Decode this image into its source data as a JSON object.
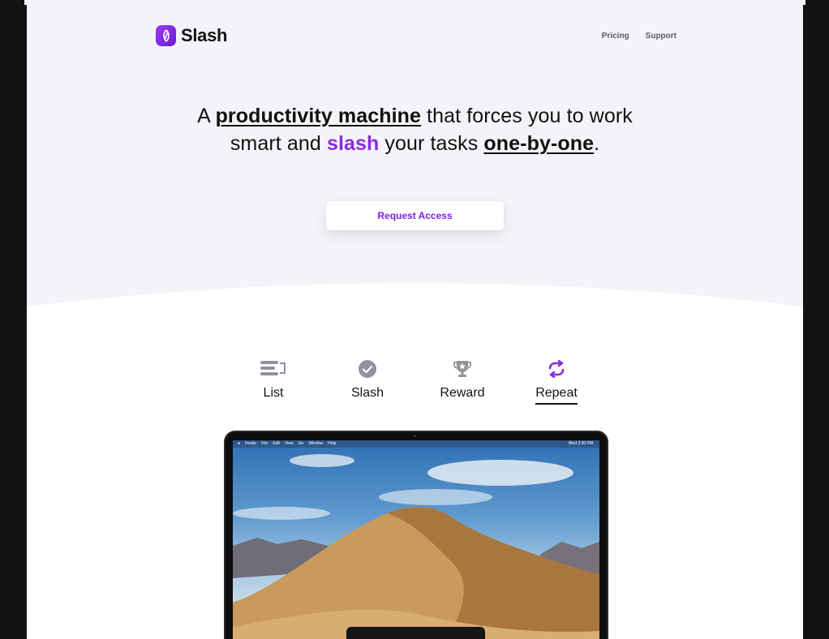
{
  "brand": {
    "name": "Slash",
    "icon": "slash-logo-icon"
  },
  "nav": {
    "items": [
      "Pricing",
      "Support"
    ]
  },
  "hero": {
    "line1_pre": "A ",
    "line1_em": "productivity machine",
    "line1_post": " that forces you to work",
    "line2_pre": "smart and ",
    "line2_accent": "slash",
    "line2_mid": " your tasks ",
    "line2_em": "one-by-one",
    "line2_post": ".",
    "cta_label": "Request Access"
  },
  "features": [
    {
      "label": "List",
      "icon": "list-icon",
      "active": false
    },
    {
      "label": "Slash",
      "icon": "check-circle-icon",
      "active": false
    },
    {
      "label": "Reward",
      "icon": "trophy-icon",
      "active": false
    },
    {
      "label": "Repeat",
      "icon": "repeat-icon",
      "active": true
    }
  ],
  "screen": {
    "menubar_items": [
      "Finder",
      "File",
      "Edit",
      "View",
      "Go",
      "Window",
      "Help"
    ],
    "clock": "Wed 3:30 PM"
  },
  "colors": {
    "accent": "#8a2be2",
    "hero_bg": "#f4f4f8",
    "icon_gray": "#8f949e",
    "outer_bg": "#121314"
  }
}
